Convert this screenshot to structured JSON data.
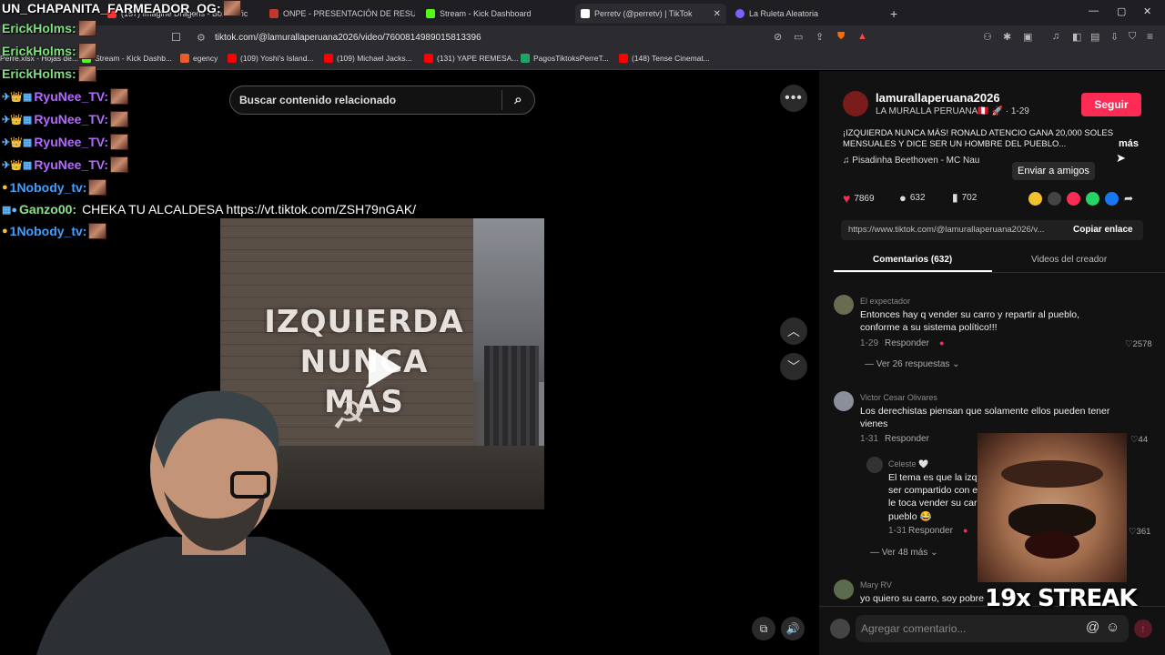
{
  "browser": {
    "tabs": [
      {
        "label": "(157) Imagine Dragons - Bo... Offic",
        "favicon_color": "#ff3333"
      },
      {
        "label": "ONPE - PRESENTACIÓN DE RESULTA...",
        "favicon_color": "#c0392b"
      },
      {
        "label": "Stream - Kick Dashboard",
        "favicon_color": "#53fc18"
      },
      {
        "label": "Perretv (@perretv) | TikTok",
        "favicon_color": "#ffffff"
      },
      {
        "label": "La Ruleta Aleatoria",
        "favicon_color": "#7b61ff"
      }
    ],
    "active_tab_overlay": "Perretv (@perretv)",
    "url": "tiktok.com/@lamurallaperuana2026/video/7600814989015813396",
    "bookmarks": [
      {
        "label": "Perre.xlsx - Hojas de...",
        "color": "#1fa463"
      },
      {
        "label": "Stream - Kick Dashb...",
        "color": "#53fc18"
      },
      {
        "label": "egency",
        "color": "#e85d2a"
      },
      {
        "label": "(109) Yoshi's Island...",
        "color": "#ff0000"
      },
      {
        "label": "(109) Michael Jacks...",
        "color": "#ff0000"
      },
      {
        "label": "(131) YAPE REMESA...",
        "color": "#ff0000"
      },
      {
        "label": "PagosTiktoksPerreT...",
        "color": "#1fa463"
      },
      {
        "label": "(148) Tense Cinemat...",
        "color": "#ff0000"
      }
    ]
  },
  "chat": [
    {
      "user": "UN_CHAPANITA_FARMEADOR_OG:",
      "color": "#ffffff",
      "badges": "",
      "message": ""
    },
    {
      "user": "ErickHolms:",
      "color": "#7fe07f",
      "badges": "",
      "message": ""
    },
    {
      "user": "ErickHolms:",
      "color": "#7fe07f",
      "badges": "",
      "message": ""
    },
    {
      "user": "ErickHolms:",
      "color": "#7fe07f",
      "badges": "",
      "message": ""
    },
    {
      "user": "RyuNee_TV:",
      "color": "#b36bff",
      "badges": "✈👑▦",
      "message": ""
    },
    {
      "user": "RyuNee_TV:",
      "color": "#b36bff",
      "badges": "✈👑▦",
      "message": ""
    },
    {
      "user": "RyuNee_TV:",
      "color": "#b36bff",
      "badges": "✈👑▦",
      "message": ""
    },
    {
      "user": "RyuNee_TV:",
      "color": "#b36bff",
      "badges": "✈👑▦",
      "message": ""
    },
    {
      "user": "1Nobody_tv:",
      "color": "#3ea0ff",
      "badges": "●",
      "message": ""
    },
    {
      "user": "Ganzo00:",
      "color": "#8fe08f",
      "badges": "▦●",
      "message": "CHEKA TU ALCALDESA https://vt.tiktok.com/ZSH79nGAK/"
    },
    {
      "user": "1Nobody_tv:",
      "color": "#3ea0ff",
      "badges": "●",
      "message": ""
    }
  ],
  "search": {
    "placeholder": "Buscar contenido relacionado"
  },
  "video": {
    "overlay_text": "IZQUIERDA NUNCA MÁS",
    "line1": "IZQUIERDA",
    "line2": "NUNCA MÁS"
  },
  "panel": {
    "username": "lamurallaperuana2026",
    "display_name": "LA MURALLA PERUANA🇵🇪 🚀 · 1-29",
    "follow_label": "Seguir",
    "description_line1": "¡IZQUIERDA NUNCA MÁS! RONALD ATENCIO GANA 20,000 SOLES",
    "description_line2": "MENSUALES Y DICE SER UN HOMBRE DEL PUEBLO...",
    "more_label": "más",
    "music": "Pisadinha Beethoven - MC Nau",
    "tooltip": "Enviar a amigos",
    "likes": "7869",
    "comments_count": "632",
    "saves": "702",
    "link": "https://www.tiktok.com/@lamurallaperuana2026/v...",
    "copy_label": "Copiar enlace",
    "tab_comments": "Comentarios (632)",
    "tab_videos": "Videos del creador",
    "accent": "#fe2c55"
  },
  "comments": [
    {
      "author": "El expectador",
      "text1": "Entonces hay q vender su carro y repartir al pueblo,",
      "text2": "conforme a su sistema político!!!",
      "date": "1-29",
      "reply_label": "Responder",
      "likes": "2578",
      "replies": "Ver 26 respuestas"
    },
    {
      "author": "Victor Cesar Olivares",
      "text1": "Los derechistas piensan que solamente ellos pueden tener",
      "text2": "vienes",
      "date": "1-31",
      "reply_label": "Responder",
      "likes": "44"
    },
    {
      "author": "Celeste 🤍",
      "text1": "El tema es que la izq",
      "text2": "ser compartido con e",
      "text3": "le toca vender su car",
      "text4": "pueblo 😂",
      "date": "1-31",
      "reply_label": "Responder",
      "likes": "361",
      "replies": "Ver 48 más"
    },
    {
      "author": "Mary RV",
      "text1": "yo quiero su carro, soy pobre"
    }
  ],
  "comment_input": {
    "placeholder": "Agregar comentario..."
  },
  "overlay": {
    "streak": "19x STREAK"
  }
}
